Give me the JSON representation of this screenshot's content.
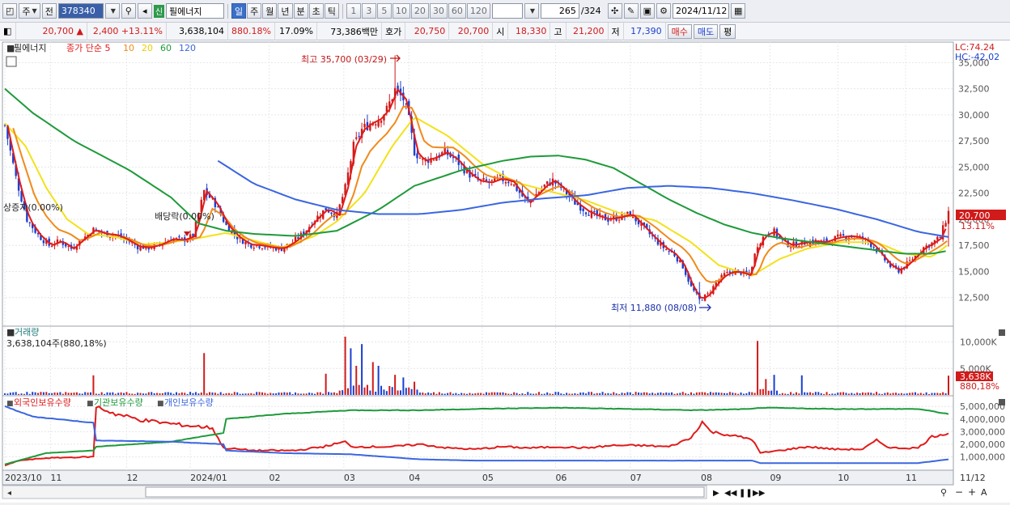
{
  "toolbar": {
    "type_label": "주",
    "prev_label": "전",
    "code": "378340",
    "name_tag": "신",
    "name": "필에너지",
    "periods": [
      "일",
      "주",
      "월",
      "년",
      "분",
      "초",
      "틱"
    ],
    "active_period": "일",
    "intervals": [
      "1",
      "3",
      "5",
      "10",
      "20",
      "30",
      "60",
      "120"
    ],
    "count": "265",
    "total": "/324",
    "date": "2024/11/12"
  },
  "quote": {
    "price": "20,700",
    "arrow": "▲",
    "change": "2,400",
    "change_rate": "+13.11%",
    "volume": "3,638,104",
    "vol_ratio": "880.18%",
    "turnover": "17.09%",
    "amount": "73,386백만",
    "bid_label": "호가",
    "bid1": "20,750",
    "bid2": "20,700",
    "open_label": "시",
    "open": "18,330",
    "high_label": "고",
    "high": "21,200",
    "low_label": "저",
    "low": "17,390",
    "buy_label": "매수",
    "sell_label": "매도",
    "eval_label": "평"
  },
  "colors": {
    "up": "#d11a1a",
    "down": "#1a3fd1",
    "ma5": "#e01b1b",
    "ma10": "#f08a1c",
    "ma20": "#f2e21a",
    "ma60": "#1e9a3a",
    "ma120": "#3a66e0",
    "foreign": "#e01b1b",
    "institution": "#1e9a3a",
    "individual": "#3a66e0"
  },
  "chart_data": [
    {
      "type": "candlestick",
      "title": "필에너지",
      "legend": [
        {
          "text": "종가 단순 5",
          "color": "#e01b1b"
        },
        {
          "text": "10",
          "color": "#f08a1c"
        },
        {
          "text": "20",
          "color": "#e8d000"
        },
        {
          "text": "60",
          "color": "#1e9a3a"
        },
        {
          "text": "120",
          "color": "#3a66e0"
        }
      ],
      "ylim": [
        10000,
        36500
      ],
      "y_ticks": [
        "12,500",
        "15,000",
        "17,500",
        "20,000",
        "22,500",
        "25,000",
        "27,500",
        "30,000",
        "32,500",
        "35,000"
      ],
      "lc_label": "LC:74.24",
      "hc_label": "HC:-42.02",
      "last_price": "20,700",
      "last_rate": "13.11%",
      "annotations": {
        "high": "최고 35,700 (03/29)",
        "low": "최저 11,880 (08/08)",
        "dividend": "배당락(0.00%)",
        "capital": "상증자(0.00%)"
      },
      "close_points": [
        [
          0,
          29000
        ],
        [
          8,
          24000
        ],
        [
          16,
          20000
        ],
        [
          24,
          18500
        ],
        [
          32,
          17500
        ],
        [
          40,
          17900
        ],
        [
          48,
          17200
        ],
        [
          56,
          18100
        ],
        [
          64,
          19000
        ],
        [
          72,
          18600
        ],
        [
          80,
          18500
        ],
        [
          88,
          18000
        ],
        [
          96,
          17400
        ],
        [
          104,
          17300
        ],
        [
          112,
          17600
        ],
        [
          120,
          18100
        ],
        [
          128,
          18000
        ],
        [
          136,
          18400
        ],
        [
          144,
          22700
        ],
        [
          152,
          21500
        ],
        [
          160,
          19400
        ],
        [
          168,
          18300
        ],
        [
          176,
          17600
        ],
        [
          184,
          17500
        ],
        [
          192,
          17300
        ],
        [
          200,
          17200
        ],
        [
          208,
          17800
        ],
        [
          216,
          18700
        ],
        [
          224,
          20000
        ],
        [
          232,
          21000
        ],
        [
          240,
          20400
        ],
        [
          246,
          23000
        ],
        [
          252,
          27000
        ],
        [
          258,
          28600
        ],
        [
          264,
          29200
        ],
        [
          270,
          29600
        ],
        [
          276,
          30500
        ],
        [
          282,
          32400
        ],
        [
          288,
          31500
        ],
        [
          292,
          29500
        ],
        [
          296,
          26500
        ],
        [
          302,
          25600
        ],
        [
          310,
          25900
        ],
        [
          318,
          26400
        ],
        [
          326,
          25700
        ],
        [
          334,
          24500
        ],
        [
          342,
          23700
        ],
        [
          350,
          23500
        ],
        [
          358,
          23900
        ],
        [
          366,
          23600
        ],
        [
          374,
          22200
        ],
        [
          378,
          21600
        ],
        [
          384,
          22400
        ],
        [
          390,
          23200
        ],
        [
          396,
          23700
        ],
        [
          404,
          22800
        ],
        [
          412,
          21600
        ],
        [
          420,
          20800
        ],
        [
          428,
          20300
        ],
        [
          436,
          20000
        ],
        [
          444,
          20200
        ],
        [
          452,
          20500
        ],
        [
          460,
          19400
        ],
        [
          468,
          18300
        ],
        [
          476,
          17300
        ],
        [
          484,
          16600
        ],
        [
          490,
          15500
        ],
        [
          496,
          13500
        ],
        [
          502,
          12300
        ],
        [
          508,
          12800
        ],
        [
          514,
          13900
        ],
        [
          520,
          14700
        ],
        [
          526,
          15000
        ],
        [
          532,
          14900
        ],
        [
          538,
          14600
        ],
        [
          544,
          17600
        ],
        [
          550,
          18600
        ],
        [
          556,
          18800
        ],
        [
          562,
          17900
        ],
        [
          568,
          17500
        ],
        [
          574,
          17700
        ],
        [
          580,
          17800
        ],
        [
          586,
          17900
        ],
        [
          592,
          17800
        ],
        [
          598,
          18100
        ],
        [
          604,
          18300
        ],
        [
          610,
          18400
        ],
        [
          616,
          18300
        ],
        [
          622,
          18000
        ],
        [
          628,
          17400
        ],
        [
          634,
          16400
        ],
        [
          640,
          15500
        ],
        [
          646,
          15100
        ],
        [
          652,
          15700
        ],
        [
          658,
          16500
        ],
        [
          664,
          17300
        ],
        [
          670,
          17700
        ],
        [
          676,
          18300
        ],
        [
          682,
          20700
        ]
      ],
      "ma20_points": [
        [
          0,
          29200
        ],
        [
          15,
          27000
        ],
        [
          30,
          23000
        ],
        [
          45,
          20000
        ],
        [
          60,
          18600
        ],
        [
          80,
          18300
        ],
        [
          100,
          17600
        ],
        [
          120,
          17800
        ],
        [
          140,
          18200
        ],
        [
          160,
          18700
        ],
        [
          176,
          18100
        ],
        [
          200,
          17300
        ],
        [
          224,
          18400
        ],
        [
          240,
          19800
        ],
        [
          260,
          22500
        ],
        [
          280,
          27000
        ],
        [
          296,
          29800
        ],
        [
          320,
          28000
        ],
        [
          346,
          25200
        ],
        [
          370,
          23500
        ],
        [
          396,
          22600
        ],
        [
          420,
          21800
        ],
        [
          444,
          20600
        ],
        [
          470,
          19900
        ],
        [
          496,
          17800
        ],
        [
          516,
          15600
        ],
        [
          540,
          14600
        ],
        [
          560,
          16200
        ],
        [
          580,
          17200
        ],
        [
          604,
          17800
        ],
        [
          630,
          17800
        ],
        [
          650,
          16700
        ],
        [
          670,
          16400
        ],
        [
          682,
          17600
        ]
      ],
      "ma60_points": [
        [
          0,
          32500
        ],
        [
          20,
          30200
        ],
        [
          50,
          27500
        ],
        [
          90,
          24700
        ],
        [
          120,
          22100
        ],
        [
          140,
          19600
        ],
        [
          160,
          18900
        ],
        [
          180,
          18600
        ],
        [
          210,
          18400
        ],
        [
          240,
          18900
        ],
        [
          270,
          20900
        ],
        [
          296,
          23200
        ],
        [
          330,
          24700
        ],
        [
          360,
          25600
        ],
        [
          380,
          26000
        ],
        [
          400,
          26100
        ],
        [
          420,
          25700
        ],
        [
          440,
          24900
        ],
        [
          460,
          23400
        ],
        [
          480,
          21900
        ],
        [
          500,
          20600
        ],
        [
          520,
          19500
        ],
        [
          540,
          18700
        ],
        [
          560,
          18200
        ],
        [
          590,
          17700
        ],
        [
          620,
          17200
        ],
        [
          650,
          16700
        ],
        [
          670,
          16700
        ],
        [
          682,
          17000
        ]
      ],
      "ma120_points": [
        [
          154,
          25600
        ],
        [
          180,
          23400
        ],
        [
          210,
          21900
        ],
        [
          240,
          20900
        ],
        [
          270,
          20500
        ],
        [
          300,
          20500
        ],
        [
          330,
          20900
        ],
        [
          360,
          21600
        ],
        [
          390,
          22000
        ],
        [
          420,
          22300
        ],
        [
          450,
          23000
        ],
        [
          480,
          23200
        ],
        [
          510,
          23000
        ],
        [
          540,
          22500
        ],
        [
          570,
          21800
        ],
        [
          600,
          21000
        ],
        [
          630,
          20000
        ],
        [
          660,
          18800
        ],
        [
          682,
          18300
        ]
      ]
    },
    {
      "type": "bar",
      "title": "거래량",
      "subtitle": "3,638,104주(880,18%)",
      "y_ticks": [
        "5,000K",
        "10,000K"
      ],
      "last_value": "3,638K",
      "last_rate": "880,18%",
      "ylim": [
        0,
        11000
      ],
      "spikes": [
        {
          "x": 64,
          "value": 3700,
          "dir": "up"
        },
        {
          "x": 144,
          "value": 7900,
          "dir": "up"
        },
        {
          "x": 232,
          "value": 4000,
          "dir": "up"
        },
        {
          "x": 246,
          "value": 11000,
          "dir": "up"
        },
        {
          "x": 250,
          "value": 8800,
          "dir": "down"
        },
        {
          "x": 254,
          "value": 5500,
          "dir": "up"
        },
        {
          "x": 258,
          "value": 9600,
          "dir": "down"
        },
        {
          "x": 266,
          "value": 6200,
          "dir": "up"
        },
        {
          "x": 270,
          "value": 5500,
          "dir": "down"
        },
        {
          "x": 282,
          "value": 3800,
          "dir": "up"
        },
        {
          "x": 288,
          "value": 3300,
          "dir": "down"
        },
        {
          "x": 296,
          "value": 2500,
          "dir": "up"
        },
        {
          "x": 544,
          "value": 10200,
          "dir": "up"
        },
        {
          "x": 550,
          "value": 3000,
          "dir": "up"
        },
        {
          "x": 556,
          "value": 3800,
          "dir": "down"
        },
        {
          "x": 576,
          "value": 3700,
          "dir": "down"
        },
        {
          "x": 682,
          "value": 3638,
          "dir": "up"
        }
      ]
    },
    {
      "type": "line",
      "series": [
        {
          "name": "외국인보유수량",
          "color": "#e01b1b",
          "values": [
            [
              0,
              300000
            ],
            [
              10,
              700000
            ],
            [
              30,
              900000
            ],
            [
              64,
              1000000
            ],
            [
              66,
              5000000
            ],
            [
              80,
              4400000
            ],
            [
              100,
              3900000
            ],
            [
              130,
              3500000
            ],
            [
              150,
              3300000
            ],
            [
              158,
              1700000
            ],
            [
              180,
              1500000
            ],
            [
              210,
              1500000
            ],
            [
              230,
              1800000
            ],
            [
              246,
              2200000
            ],
            [
              250,
              1800000
            ],
            [
              280,
              1800000
            ],
            [
              300,
              2000000
            ],
            [
              320,
              1700000
            ],
            [
              340,
              1600000
            ],
            [
              360,
              1800000
            ],
            [
              380,
              1700000
            ],
            [
              400,
              1800000
            ],
            [
              420,
              1700000
            ],
            [
              440,
              1900000
            ],
            [
              460,
              1900000
            ],
            [
              480,
              1800000
            ],
            [
              496,
              2500000
            ],
            [
              504,
              3800000
            ],
            [
              510,
              3000000
            ],
            [
              530,
              2600000
            ],
            [
              540,
              2400000
            ],
            [
              546,
              1300000
            ],
            [
              560,
              1500000
            ],
            [
              580,
              1800000
            ],
            [
              600,
              1600000
            ],
            [
              620,
              1600000
            ],
            [
              630,
              2300000
            ],
            [
              640,
              1700000
            ],
            [
              660,
              1700000
            ],
            [
              670,
              2600000
            ],
            [
              682,
              2900000
            ]
          ]
        },
        {
          "name": "기관보유수량",
          "color": "#1e9a3a",
          "values": [
            [
              0,
              400000
            ],
            [
              30,
              1300000
            ],
            [
              64,
              1500000
            ],
            [
              66,
              1800000
            ],
            [
              120,
              2200000
            ],
            [
              158,
              2900000
            ],
            [
              160,
              4000000
            ],
            [
              200,
              4400000
            ],
            [
              250,
              4700000
            ],
            [
              300,
              4700000
            ],
            [
              340,
              4800000
            ],
            [
              400,
              4900000
            ],
            [
              450,
              4800000
            ],
            [
              500,
              4700000
            ],
            [
              540,
              4800000
            ],
            [
              546,
              4900000
            ],
            [
              600,
              4800000
            ],
            [
              660,
              4800000
            ],
            [
              682,
              4400000
            ]
          ]
        },
        {
          "name": "개인보유수량",
          "color": "#3a66e0",
          "values": [
            [
              0,
              5000000
            ],
            [
              20,
              4200000
            ],
            [
              64,
              3700000
            ],
            [
              66,
              2300000
            ],
            [
              120,
              2200000
            ],
            [
              158,
              2000000
            ],
            [
              160,
              1500000
            ],
            [
              200,
              1300000
            ],
            [
              250,
              1200000
            ],
            [
              300,
              800000
            ],
            [
              340,
              700000
            ],
            [
              400,
              700000
            ],
            [
              450,
              700000
            ],
            [
              500,
              700000
            ],
            [
              540,
              700000
            ],
            [
              546,
              500000
            ],
            [
              600,
              500000
            ],
            [
              660,
              500000
            ],
            [
              682,
              800000
            ]
          ]
        }
      ],
      "y_ticks": [
        "1,000,000",
        "2,000,000",
        "3,000,000",
        "4,000,000",
        "5,000,000"
      ],
      "ylim": [
        0,
        5400000
      ]
    }
  ],
  "x_axis": {
    "labels": [
      "2023/10",
      "11",
      "12",
      "2024/01",
      "02",
      "03",
      "04",
      "05",
      "06",
      "07",
      "08",
      "09",
      "10",
      "11"
    ],
    "right_label": "11/12"
  }
}
